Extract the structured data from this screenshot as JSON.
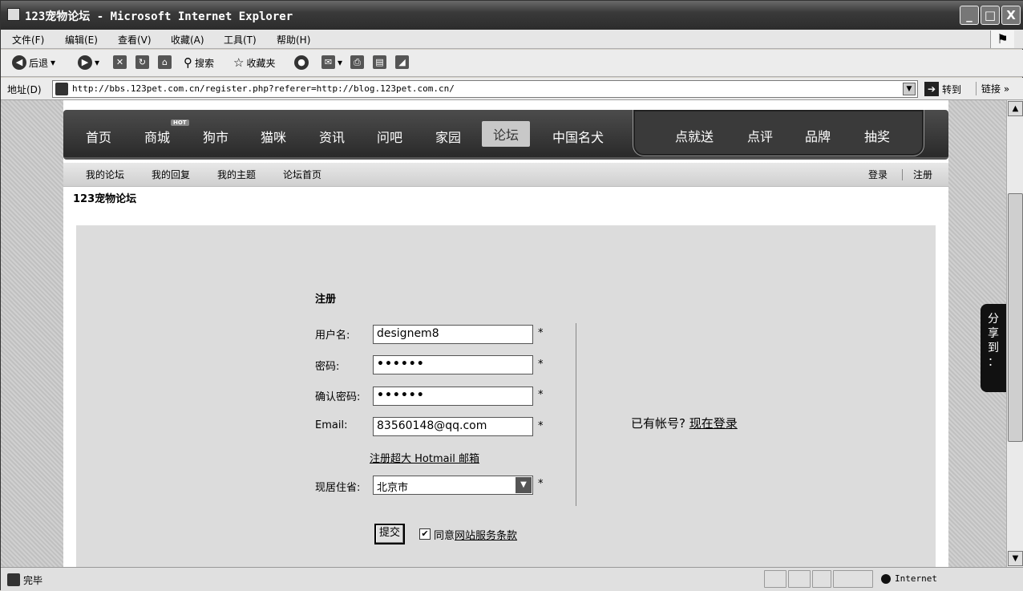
{
  "window": {
    "title": "123宠物论坛 - Microsoft Internet Explorer",
    "controls": [
      "_",
      "□",
      "X"
    ]
  },
  "menu": [
    "文件(F)",
    "编辑(E)",
    "查看(V)",
    "收藏(A)",
    "工具(T)",
    "帮助(H)"
  ],
  "toolbar": {
    "back": "后退",
    "search": "搜索",
    "favorites": "收藏夹"
  },
  "address": {
    "label": "地址(D)",
    "url": "http://bbs.123pet.com.cn/register.php?referer=http://blog.123pet.com.cn/",
    "go": "转到",
    "links": "链接"
  },
  "nav": {
    "items": [
      "首页",
      "商城",
      "狗市",
      "猫咪",
      "资讯",
      "问吧",
      "家园",
      "论坛",
      "中国名犬"
    ],
    "hot_badge": "HOT",
    "active": "论坛",
    "box_items": [
      "点就送",
      "点评",
      "品牌",
      "抽奖"
    ]
  },
  "subnav": {
    "left": [
      "我的论坛",
      "我的回复",
      "我的主题",
      "论坛首页"
    ],
    "right": [
      "登录",
      "注册"
    ]
  },
  "site_name": "123宠物论坛",
  "register": {
    "title": "注册",
    "username_label": "用户名:",
    "username_value": "designem8",
    "password_label": "密码:",
    "password_value": "••••••",
    "confirm_label": "确认密码:",
    "confirm_value": "••••••",
    "email_label": "Email:",
    "email_value": "83560148@qq.com",
    "required": "*",
    "hotmail_link": "注册超大 Hotmail 邮箱",
    "province_label": "现居住省:",
    "province_value": "北京市",
    "submit": "提交",
    "agree_prefix": "同意",
    "agree_link": "网站服务条款",
    "has_account": "已有帐号?",
    "login_now": "现在登录"
  },
  "share_tab": "分享到：",
  "status": {
    "text": "完毕",
    "zone": "Internet"
  }
}
